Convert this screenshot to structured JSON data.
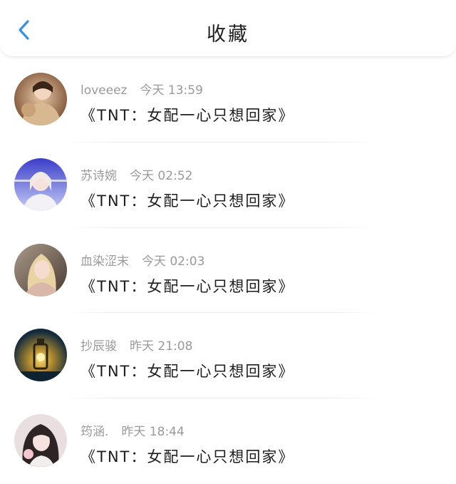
{
  "header": {
    "title": "收藏",
    "back_icon": "chevron-left-icon",
    "accent_color": "#3a8fe0"
  },
  "favorites": [
    {
      "username": "loveeez",
      "time": "今天 13:59",
      "message": "《TNT：女配一心只想回家》"
    },
    {
      "username": "苏诗婉",
      "time": "今天 02:52",
      "message": "《TNT：女配一心只想回家》"
    },
    {
      "username": "血染涩末",
      "time": "今天 02:03",
      "message": "《TNT：女配一心只想回家》"
    },
    {
      "username": "抄辰骏",
      "time": "昨天 21:08",
      "message": "《TNT：女配一心只想回家》"
    },
    {
      "username": "筠涵.",
      "time": "昨天 18:44",
      "message": "《TNT：女配一心只想回家》"
    }
  ]
}
